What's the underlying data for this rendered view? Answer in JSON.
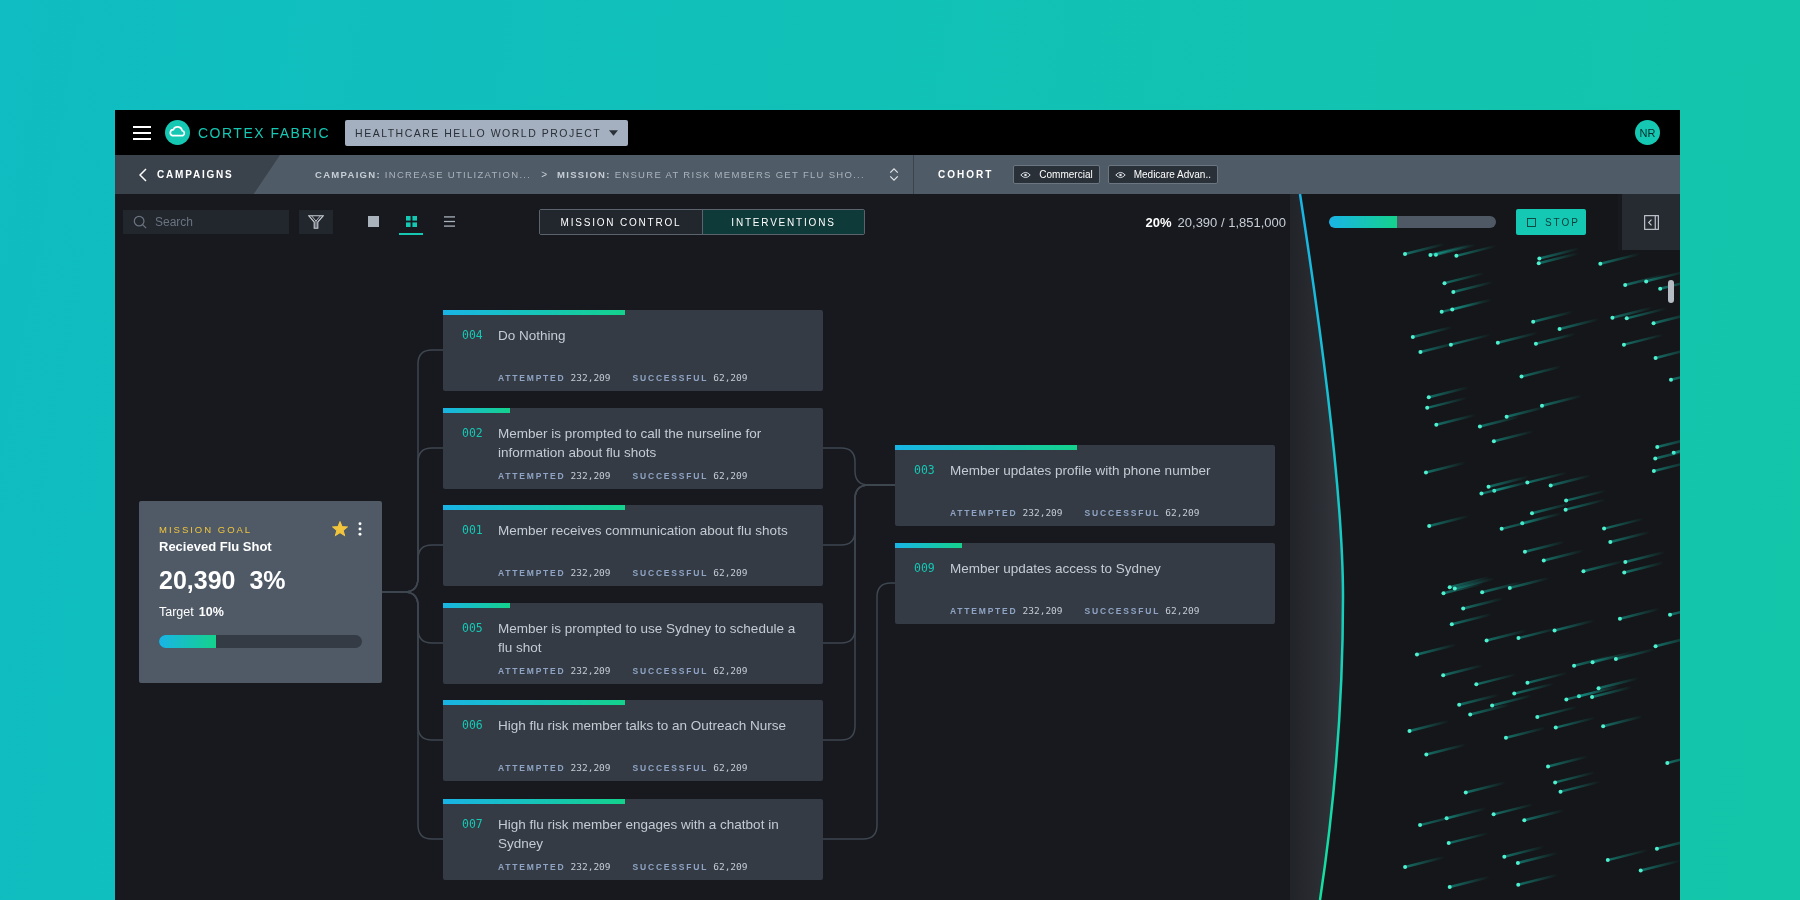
{
  "app": {
    "brand": "CORTEX FABRIC",
    "project": "HEALTHCARE HELLO WORLD PROJECT",
    "avatar": "NR"
  },
  "breadcrumb": {
    "back": "CAMPAIGNS",
    "separator": ">",
    "items": [
      {
        "label": "CAMPAIGN:",
        "value": "INCREASE UTILIZATION..."
      },
      {
        "label": "MISSION:",
        "value": "ENSURE AT RISK MEMBERS GET FLU SHO..."
      }
    ]
  },
  "cohort": {
    "label": "COHORT",
    "chips": [
      "Commercial",
      "Medicare Advan.."
    ]
  },
  "toolbar": {
    "search_placeholder": "Search",
    "views": [
      {
        "kind": "single",
        "selected": false
      },
      {
        "kind": "grid",
        "selected": true
      },
      {
        "kind": "list",
        "selected": false
      }
    ],
    "tabs": [
      {
        "label": "MISSION CONTROL",
        "selected": false
      },
      {
        "label": "INTERVENTIONS",
        "selected": true
      }
    ],
    "percent": "20%",
    "count": "20,390 / 1,851,000",
    "level": 0.41,
    "stop": "STOP"
  },
  "mission_goal": {
    "heading": "MISSION GOAL",
    "title": "Recieved Flu Shot",
    "starred": true,
    "value": "20,390",
    "percent": "3%",
    "target_label": "Target",
    "target": "10%",
    "level": 0.28
  },
  "stages": [
    {
      "cards": [
        {
          "id": "004",
          "text": "Do Nothing",
          "attempted_label": "ATTEMPTED",
          "attempted": "232,209",
          "successful_label": "SUCCESSFUL",
          "successful": "62,209",
          "level": 0.48
        },
        {
          "id": "002",
          "text": "Member is prompted to call the nurseline for information about flu shots",
          "attempted_label": "ATTEMPTED",
          "attempted": "232,209",
          "successful_label": "SUCCESSFUL",
          "successful": "62,209",
          "level": 0.175
        },
        {
          "id": "001",
          "text": "Member receives communication about flu shots",
          "attempted_label": "ATTEMPTED",
          "attempted": "232,209",
          "successful_label": "SUCCESSFUL",
          "successful": "62,209",
          "level": 0.48
        },
        {
          "id": "005",
          "text": "Member is prompted to use Sydney to schedule a flu shot",
          "attempted_label": "ATTEMPTED",
          "attempted": "232,209",
          "successful_label": "SUCCESSFUL",
          "successful": "62,209",
          "level": 0.175
        },
        {
          "id": "006",
          "text": "High flu risk member talks to an Outreach Nurse",
          "attempted_label": "ATTEMPTED",
          "attempted": "232,209",
          "successful_label": "SUCCESSFUL",
          "successful": "62,209",
          "level": 0.48
        },
        {
          "id": "007",
          "text": "High flu risk member engages with a chatbot in Sydney",
          "attempted_label": "ATTEMPTED",
          "attempted": "232,209",
          "successful_label": "SUCCESSFUL",
          "successful": "62,209",
          "level": 0.48
        }
      ]
    },
    {
      "cards": [
        {
          "id": "003",
          "text": "Member updates profile with phone number",
          "attempted_label": "ATTEMPTED",
          "attempted": "232,209",
          "successful_label": "SUCCESSFUL",
          "successful": "62,209",
          "level": 0.48
        },
        {
          "id": "009",
          "text": "Member updates access to Sydney",
          "attempted_label": "ATTEMPTED",
          "attempted": "232,209",
          "successful_label": "SUCCESSFUL",
          "successful": "62,209",
          "level": 0.175
        }
      ]
    }
  ]
}
